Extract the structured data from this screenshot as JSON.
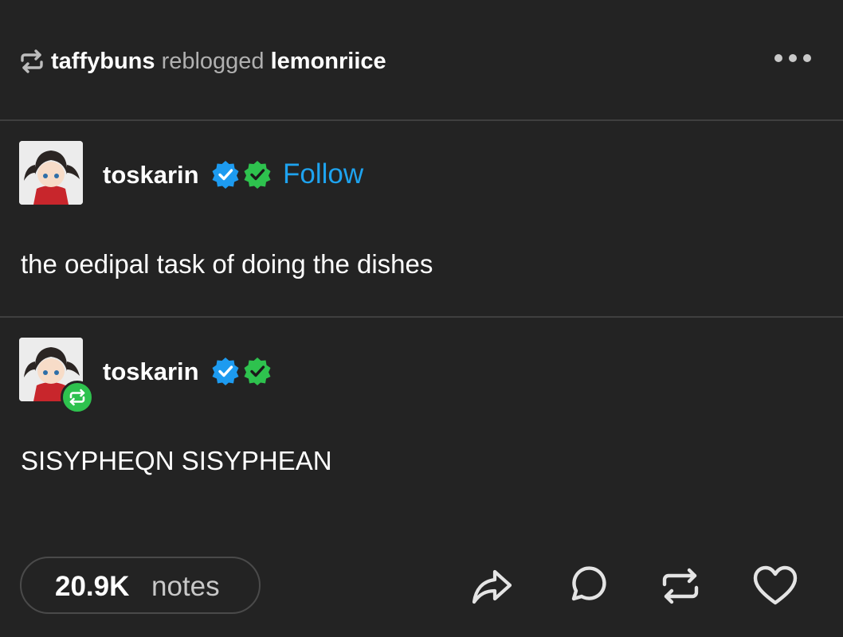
{
  "header": {
    "reblogger": "taffybuns",
    "action": "reblogged",
    "source": "lemonriice",
    "reblog_icon": "reblog-icon",
    "more_icon": "more-dots-icon"
  },
  "posts": [
    {
      "username": "toskarin",
      "badges": [
        "verified-blue-badge-icon",
        "verified-green-badge-icon"
      ],
      "follow_label": "Follow",
      "body": "the oedipal task of doing the dishes"
    },
    {
      "username": "toskarin",
      "badges": [
        "verified-blue-badge-icon",
        "verified-green-badge-icon"
      ],
      "avatar_overlay_icon": "reblog-icon",
      "body": "SISYPHEQN SISYPHEAN"
    }
  ],
  "footer": {
    "notes_count": "20.9K",
    "notes_label": "notes",
    "actions": [
      "share-icon",
      "reply-icon",
      "reblog-icon",
      "like-icon"
    ]
  },
  "colors": {
    "background": "#232323",
    "divider": "#3f3f3f",
    "follow": "#1ea3ef",
    "badge_blue": "#1d9bf0",
    "badge_green": "#2ec24e",
    "reblog_badge": "#2ec24e"
  }
}
